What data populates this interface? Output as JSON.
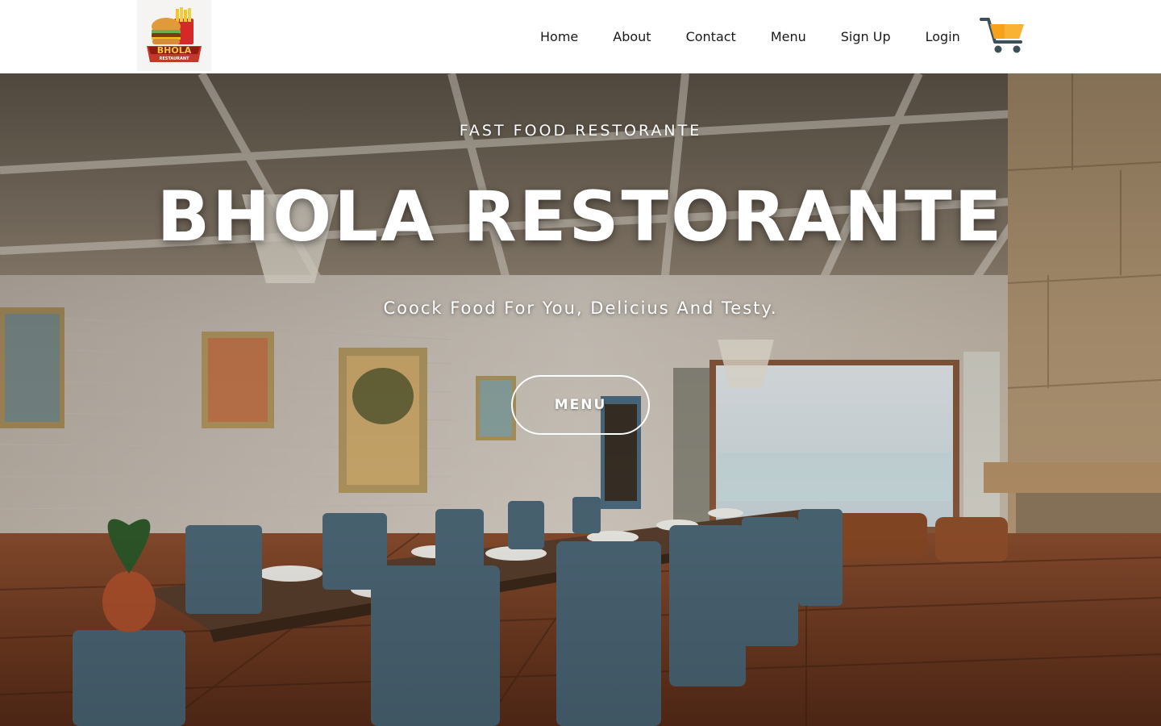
{
  "header": {
    "logo": {
      "brand": "BHOLA",
      "sub": "RESTAURANT",
      "icon": "burger-fries-logo"
    },
    "nav": [
      {
        "label": "Home"
      },
      {
        "label": "About"
      },
      {
        "label": "Contact"
      },
      {
        "label": "Menu"
      },
      {
        "label": "Sign Up"
      },
      {
        "label": "Login"
      }
    ],
    "cart_icon": "shopping-cart-icon",
    "cart_color": "#f7a21b"
  },
  "hero": {
    "subtitle": "FAST FOOD RESTORANTE",
    "title": "BHOLA RESTORANTE",
    "tagline": "Coock Food For You, Delicius And Testy.",
    "button_label": "MENU",
    "background": "restaurant-dining-room-photo"
  }
}
